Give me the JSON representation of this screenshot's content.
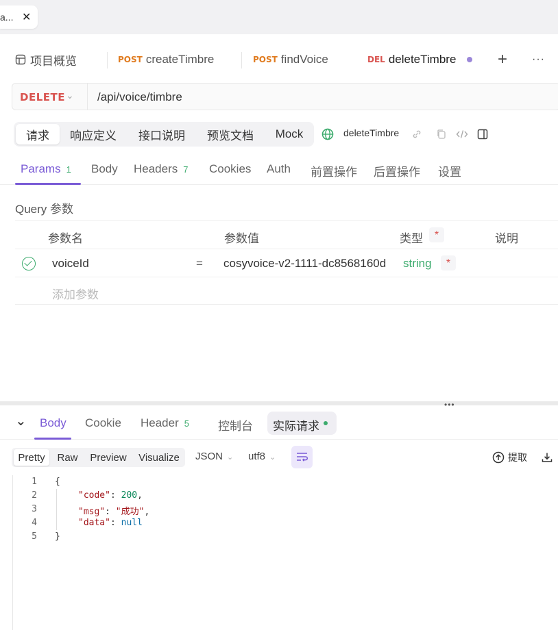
{
  "browser_tab": {
    "label": "a...",
    "close": "✕"
  },
  "tabs": {
    "overview": {
      "label": "项目概览"
    },
    "t1": {
      "method": "POST",
      "label": "createTimbre"
    },
    "t2": {
      "method": "POST",
      "label": "findVoice"
    },
    "t3": {
      "method": "DEL",
      "label": "deleteTimbre"
    },
    "add": "+",
    "more": "···"
  },
  "request": {
    "method": "DELETE",
    "url": "/api/voice/timbre"
  },
  "segments": [
    "请求",
    "响应定义",
    "接口说明",
    "预览文档",
    "Mock"
  ],
  "endpoint_name": "deleteTimbre",
  "param_tabs": {
    "params": {
      "label": "Params",
      "count": "1"
    },
    "body": {
      "label": "Body"
    },
    "headers": {
      "label": "Headers",
      "count": "7"
    },
    "cookies": {
      "label": "Cookies"
    },
    "auth": {
      "label": "Auth"
    },
    "pre": {
      "label": "前置操作"
    },
    "post": {
      "label": "后置操作"
    },
    "settings": {
      "label": "设置"
    }
  },
  "query": {
    "label": "Query 参数",
    "headers": {
      "name": "参数名",
      "value": "参数值",
      "type": "类型",
      "required": "*",
      "desc": "说明"
    },
    "row": {
      "name": "voiceId",
      "eq": "=",
      "value": "cosyvoice-v2-1111-dc8568160d",
      "type": "string",
      "required": "*"
    },
    "add_placeholder": "添加参数"
  },
  "resizer_dots": "•••",
  "response_tabs": {
    "collapse": "⌄",
    "body": {
      "label": "Body"
    },
    "cookie": {
      "label": "Cookie"
    },
    "header": {
      "label": "Header",
      "count": "5"
    },
    "console": {
      "label": "控制台"
    },
    "actual": {
      "label": "实际请求"
    }
  },
  "format": {
    "modes": [
      "Pretty",
      "Raw",
      "Preview",
      "Visualize"
    ],
    "lang": "JSON",
    "encoding": "utf8",
    "extract": "提取"
  },
  "code": {
    "line_numbers": [
      "1",
      "2",
      "3",
      "4",
      "5"
    ],
    "open": "{",
    "code_key": "\"code\"",
    "code_val": "200",
    "msg_key": "\"msg\"",
    "msg_val": "\"成功\"",
    "data_key": "\"data\"",
    "data_val": "null",
    "close": "}"
  }
}
